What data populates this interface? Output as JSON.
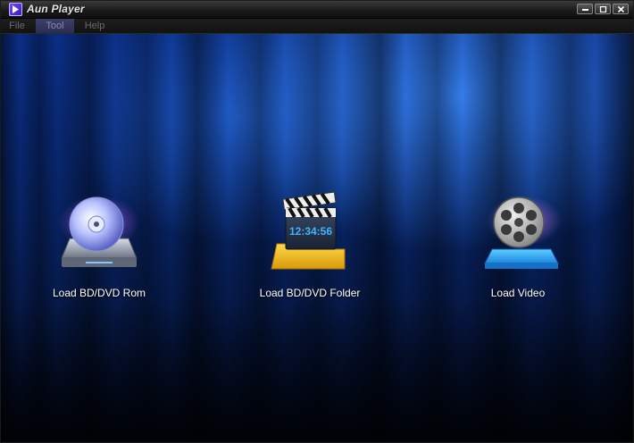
{
  "window": {
    "title": "Aun Player",
    "icon": "aun-player-logo-icon"
  },
  "menu": {
    "items": [
      {
        "label": "File"
      },
      {
        "label": "Tool"
      },
      {
        "label": "Help"
      }
    ],
    "active": "Tool"
  },
  "actions": [
    {
      "label": "Load BD/DVD Rom",
      "icon": "disc-drive-icon"
    },
    {
      "label": "Load BD/DVD Folder",
      "icon": "clapperboard-folder-icon",
      "clock_text": "12:34:56"
    },
    {
      "label": "Load Video",
      "icon": "film-reel-icon"
    }
  ],
  "colors": {
    "background_blue": "#0b2e86",
    "highlight_blue": "#3c8cff",
    "menu_active": "#3b3f6b",
    "folder_yellow": "#f5c21b",
    "video_tray_cyan": "#2aa9ff"
  }
}
